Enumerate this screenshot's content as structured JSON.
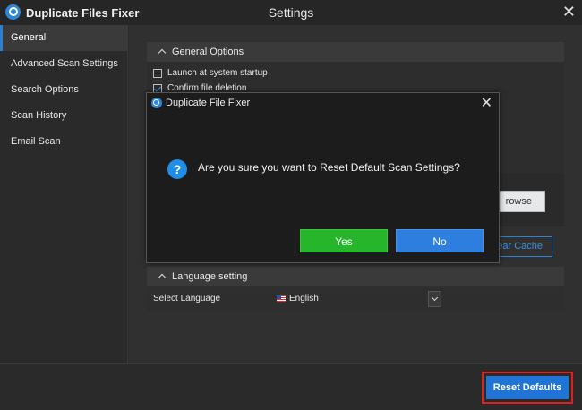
{
  "titlebar": {
    "app_name": "Duplicate Files Fixer",
    "window_title": "Settings",
    "close_glyph": "✕"
  },
  "sidebar": {
    "items": [
      {
        "label": "General",
        "active": true
      },
      {
        "label": "Advanced Scan Settings"
      },
      {
        "label": "Search Options"
      },
      {
        "label": "Scan History"
      },
      {
        "label": "Email Scan"
      }
    ]
  },
  "general_options": {
    "header": "General Options",
    "checkboxes": [
      {
        "label": "Launch at system startup",
        "checked": false
      },
      {
        "label": "Confirm file deletion",
        "checked": true
      }
    ],
    "browse_label": "rowse",
    "clear_cache_label": "lear Cache"
  },
  "language": {
    "header": "Language setting",
    "label": "Select Language",
    "selected": "English"
  },
  "footer": {
    "reset_label": "Reset Defaults"
  },
  "dialog": {
    "title": "Duplicate File Fixer",
    "close_glyph": "✕",
    "question_glyph": "?",
    "message": "Are you sure you want to Reset Default Scan Settings?",
    "yes_label": "Yes",
    "no_label": "No"
  },
  "colors": {
    "accent": "#2f7fd0",
    "yes": "#27b52b",
    "no": "#2e7ee0",
    "highlight": "#e02020"
  }
}
